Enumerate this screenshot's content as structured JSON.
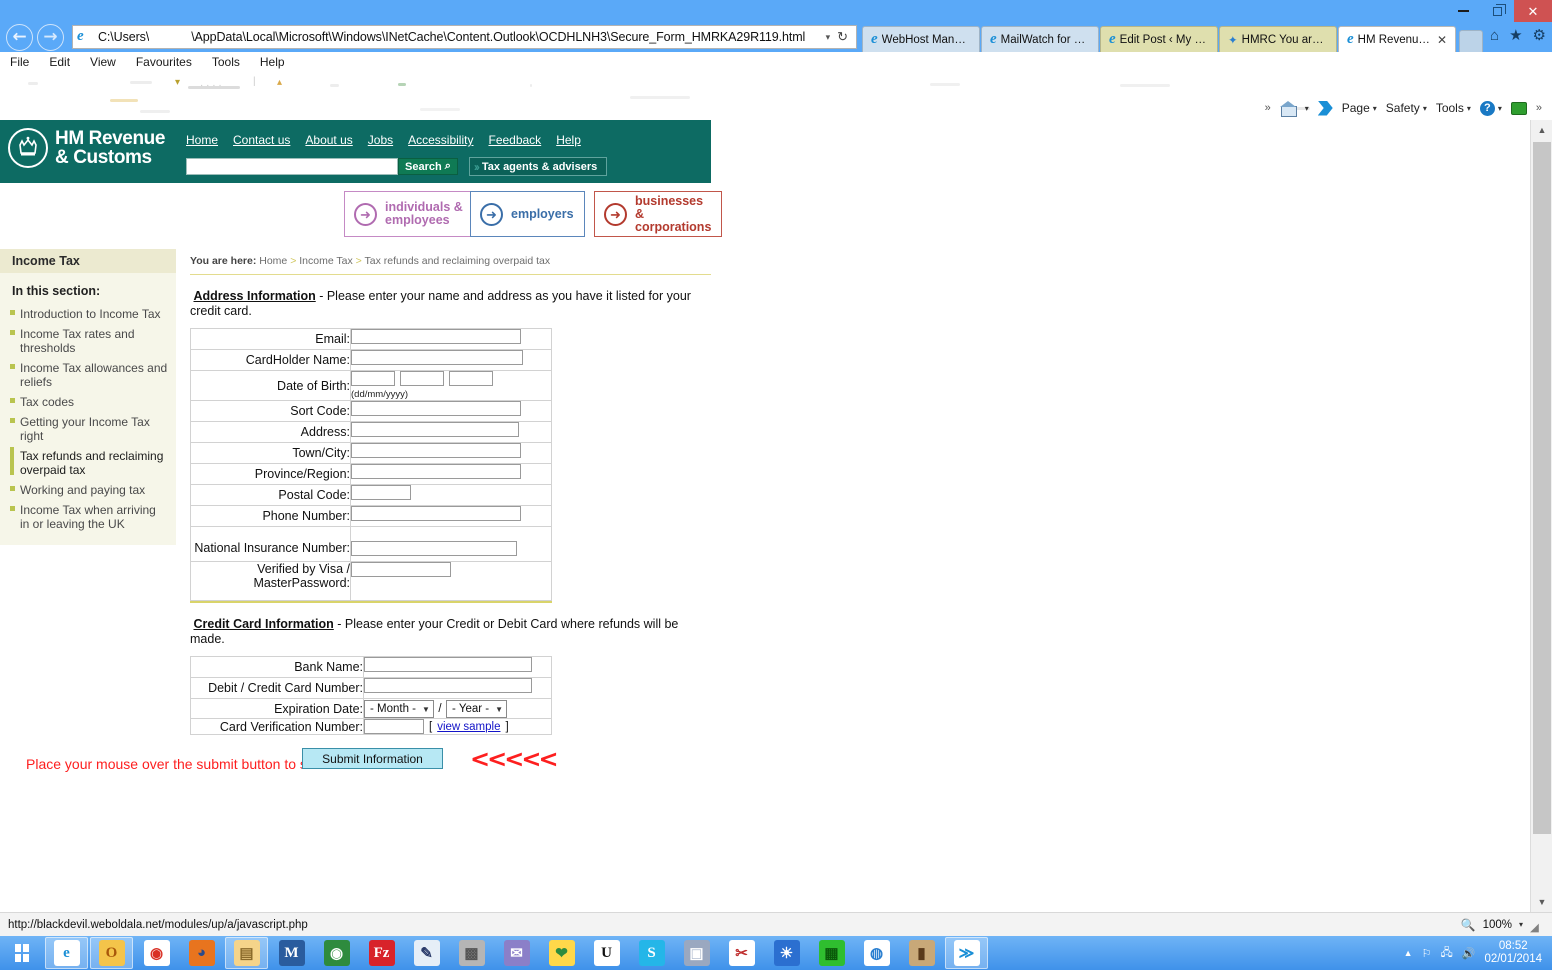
{
  "window": {
    "minimize": "–",
    "maximize": "❐",
    "close": "✕"
  },
  "browser": {
    "back_icon": "←",
    "forward_icon": "→",
    "address_prefix": "C:\\Users\\",
    "address_suffix": "\\AppData\\Local\\Microsoft\\Windows\\INetCache\\Content.Outlook\\OCDHLNH3\\Secure_Form_HMRKA29R119.html",
    "address_dropdown": "▾",
    "refresh_icon": "↻",
    "tabs": [
      {
        "label": "WebHost Manag...",
        "active": false
      },
      {
        "label": "MailWatch for M...",
        "active": false
      },
      {
        "label": "Edit Post ‹ My O...",
        "active": false
      },
      {
        "label": "HMRC You are el...",
        "active": false
      },
      {
        "label": "HM Revenue ...",
        "active": true,
        "close": "✕"
      }
    ],
    "toolbar_icons": [
      "home-icon",
      "star-icon",
      "gear-icon"
    ],
    "menus": [
      "File",
      "Edit",
      "View",
      "Favourites",
      "Tools",
      "Help"
    ],
    "command_bar": {
      "overflow_left": "»",
      "home_caret": "▾",
      "page": "Page",
      "safety": "Safety",
      "tools": "Tools",
      "help_caret": "▾",
      "caret": "▾",
      "overflow_right": "»"
    }
  },
  "hmrc": {
    "logo_line1": "HM Revenue",
    "logo_line2": "& Customs",
    "nav": [
      "Home",
      "Contact us",
      "About us",
      "Jobs",
      "Accessibility",
      "Feedback",
      "Help"
    ],
    "search": {
      "value": "",
      "button_label": "Search",
      "magnifier": "⌕"
    },
    "agents_button": "Tax agents & advisers",
    "agents_arrows": "››",
    "categories": [
      {
        "label_line1": "individuals &",
        "label_line2": "employees",
        "color": "#b06bb0",
        "arrow": "➜"
      },
      {
        "label_line1": "employers",
        "label_line2": "",
        "color": "#3a6ea8",
        "arrow": "➜"
      },
      {
        "label_line1": "businesses &",
        "label_line2": "corporations",
        "color": "#b33a2e",
        "arrow": "➜"
      }
    ]
  },
  "sidebar": {
    "title": "Income Tax",
    "subtitle": "In this section:",
    "items": [
      {
        "label": "Introduction to Income Tax",
        "current": false
      },
      {
        "label": "Income Tax rates and thresholds",
        "current": false
      },
      {
        "label": "Income Tax allowances and reliefs",
        "current": false
      },
      {
        "label": "Tax codes",
        "current": false
      },
      {
        "label": "Getting your Income Tax right",
        "current": false
      },
      {
        "label": "Tax refunds and reclaiming overpaid tax",
        "current": true
      },
      {
        "label": "Working and paying tax",
        "current": false
      },
      {
        "label": "Income Tax when arriving in or leaving the UK",
        "current": false
      }
    ]
  },
  "breadcrumb": {
    "prefix": "You are here:",
    "items": [
      "Home",
      "Income Tax",
      "Tax refunds and reclaiming overpaid tax"
    ],
    "separator": ">"
  },
  "address_section": {
    "heading": "Address Information",
    "description": " - Please enter your name and address as you have it listed for your credit card.",
    "fields": [
      {
        "label": "Email:",
        "value": "",
        "type": "text",
        "width": "w-170"
      },
      {
        "label": "CardHolder Name:",
        "value": "",
        "type": "text",
        "width": "w-172"
      },
      {
        "label": "Date of Birth:",
        "value": "",
        "type": "dob",
        "hint": "(dd/mm/yyyy)"
      },
      {
        "label": "Sort Code:",
        "value": "",
        "type": "text",
        "width": "w-170"
      },
      {
        "label": "Address:",
        "value": "",
        "type": "text",
        "width": "w-168"
      },
      {
        "label": "Town/City:",
        "value": "",
        "type": "text",
        "width": "w-170"
      },
      {
        "label": "Province/Region:",
        "value": "",
        "type": "text",
        "width": "w-170"
      },
      {
        "label": "Postal Code:",
        "value": "",
        "type": "text",
        "width": "w-60"
      },
      {
        "label": "Phone Number:",
        "value": "",
        "type": "text",
        "width": "w-170"
      },
      {
        "label": "National Insurance Number:",
        "value": "",
        "type": "text",
        "width": "w-166"
      },
      {
        "label": "Verified by Visa / MasterPassword:",
        "value": "",
        "type": "text",
        "width": "w-100"
      }
    ]
  },
  "card_section": {
    "heading": "Credit Card Information",
    "description": " - Please enter your Credit or Debit Card where refunds will be made.",
    "fields": [
      {
        "label": "Bank Name:",
        "value": "",
        "type": "text"
      },
      {
        "label": "Debit / Credit Card Number:",
        "value": "",
        "type": "text"
      },
      {
        "label": "Expiration Date:",
        "type": "expiry",
        "month": "- Month -",
        "year": "- Year -",
        "sep": "/"
      },
      {
        "label": "Card Verification Number:",
        "type": "cvv",
        "value": "",
        "bracket_open": "[",
        "link": "view sample",
        "bracket_close": "]"
      }
    ]
  },
  "submit": {
    "warning": "Place your mouse over the submit button to see the fake site",
    "button_label": "Submit Information",
    "arrows": "<<<<<"
  },
  "statusbar": {
    "url": "http://blackdevil.weboldala.net/modules/up/a/javascript.php",
    "zoom": "100%",
    "zoom_caret": "▾"
  },
  "taskbar": {
    "apps": [
      {
        "name": "internet-explorer",
        "glyph": "e",
        "bg": "#ffffff",
        "fg": "#1a8fd6",
        "active": true
      },
      {
        "name": "outlook",
        "glyph": "O",
        "bg": "#f4c44a",
        "fg": "#a8560a",
        "active": true
      },
      {
        "name": "chrome",
        "glyph": "◉",
        "bg": "#ffffff",
        "fg": "#d93025",
        "active": false
      },
      {
        "name": "firefox",
        "glyph": "◕",
        "bg": "#e8741e",
        "fg": "#2a4a8a",
        "active": false
      },
      {
        "name": "file-explorer",
        "glyph": "▤",
        "bg": "#f5d48a",
        "fg": "#8a6a2a",
        "active": true
      },
      {
        "name": "mailwatch",
        "glyph": "M",
        "bg": "#2a5c9e",
        "fg": "#ffffff",
        "active": false
      },
      {
        "name": "windows-media",
        "glyph": "◉",
        "bg": "#2e8b3e",
        "fg": "#ffffff",
        "active": false
      },
      {
        "name": "filezilla",
        "glyph": "Fz",
        "bg": "#d8232a",
        "fg": "#ffffff",
        "active": false
      },
      {
        "name": "notepad",
        "glyph": "✎",
        "bg": "#e6eef7",
        "fg": "#2a3a6a",
        "active": false
      },
      {
        "name": "firewall",
        "glyph": "▩",
        "bg": "#b5b5b5",
        "fg": "#555555",
        "active": false
      },
      {
        "name": "outlook-express",
        "glyph": "✉",
        "bg": "#8b7fc8",
        "fg": "#ffffff",
        "active": false
      },
      {
        "name": "paint",
        "glyph": "❤",
        "bg": "#ffd84a",
        "fg": "#2e8b3e",
        "active": false
      },
      {
        "name": "truecrypt",
        "glyph": "U",
        "bg": "#ffffff",
        "fg": "#111111",
        "active": false
      },
      {
        "name": "skype",
        "glyph": "S",
        "bg": "#24b6e8",
        "fg": "#ffffff",
        "active": false
      },
      {
        "name": "scanner",
        "glyph": "▣",
        "bg": "#9aa8c0",
        "fg": "#ffffff",
        "active": false
      },
      {
        "name": "snipping-tool",
        "glyph": "✂",
        "bg": "#ffffff",
        "fg": "#c03030",
        "active": false
      },
      {
        "name": "brightness",
        "glyph": "☀",
        "bg": "#2b6fd0",
        "fg": "#ffffff",
        "active": false
      },
      {
        "name": "green-app",
        "glyph": "▦",
        "bg": "#2fbe2f",
        "fg": "#0a5a0a",
        "active": false
      },
      {
        "name": "malwarebytes",
        "glyph": "◍",
        "bg": "#ffffff",
        "fg": "#2a7fd0",
        "active": false
      },
      {
        "name": "book-app",
        "glyph": "▮",
        "bg": "#c8a878",
        "fg": "#5a3a1a",
        "active": false
      },
      {
        "name": "feed-app",
        "glyph": "≫",
        "bg": "#ffffff",
        "fg": "#1a8fd6",
        "active": true
      }
    ],
    "tray_icons": [
      "show-hidden-icons",
      "flag-icon",
      "network-icon",
      "volume-icon"
    ],
    "time": "08:52",
    "date": "02/01/2014"
  }
}
